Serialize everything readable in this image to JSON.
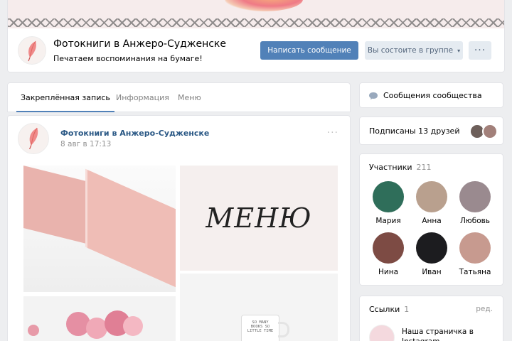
{
  "group": {
    "name": "Фотокниги в Анжеро-Судженске",
    "status": "Печатаем воспоминания на бумаге!",
    "avatar_icon": "feather-logo-icon"
  },
  "actions": {
    "message_label": "Написать сообщение",
    "membership_label": "Вы состоите в группе",
    "more_label": "···"
  },
  "tabs": [
    {
      "label": "Закреплённая запись",
      "active": true
    },
    {
      "label": "Информация",
      "active": false
    },
    {
      "label": "Меню",
      "active": false
    }
  ],
  "post": {
    "author": "Фотокниги в Анжеро-Судженске",
    "date": "8 авг в 17:13",
    "more_label": "···",
    "image_text": "МЕНЮ",
    "mug_text": "SO MANY BOOKS SO LITTLE TIME"
  },
  "sidebar": {
    "messages_label": "Сообщения сообщества",
    "friends_label": "Подписаны 13 друзей",
    "members": {
      "title": "Участники",
      "count": "211",
      "people": [
        {
          "name": "Мария",
          "color": "#2f6e5a"
        },
        {
          "name": "Анна",
          "color": "#b9a08e"
        },
        {
          "name": "Любовь",
          "color": "#9a8a8f"
        },
        {
          "name": "Нина",
          "color": "#7d4b44"
        },
        {
          "name": "Иван",
          "color": "#1c1c1f"
        },
        {
          "name": "Татьяна",
          "color": "#c79a8f"
        }
      ]
    },
    "links": {
      "title": "Ссылки",
      "count": "1",
      "edit_label": "ред.",
      "item_label": "Наша страничка в Instagram"
    }
  },
  "colors": {
    "accent": "#5181b8",
    "link": "#2a5885",
    "background": "#edeef0"
  }
}
